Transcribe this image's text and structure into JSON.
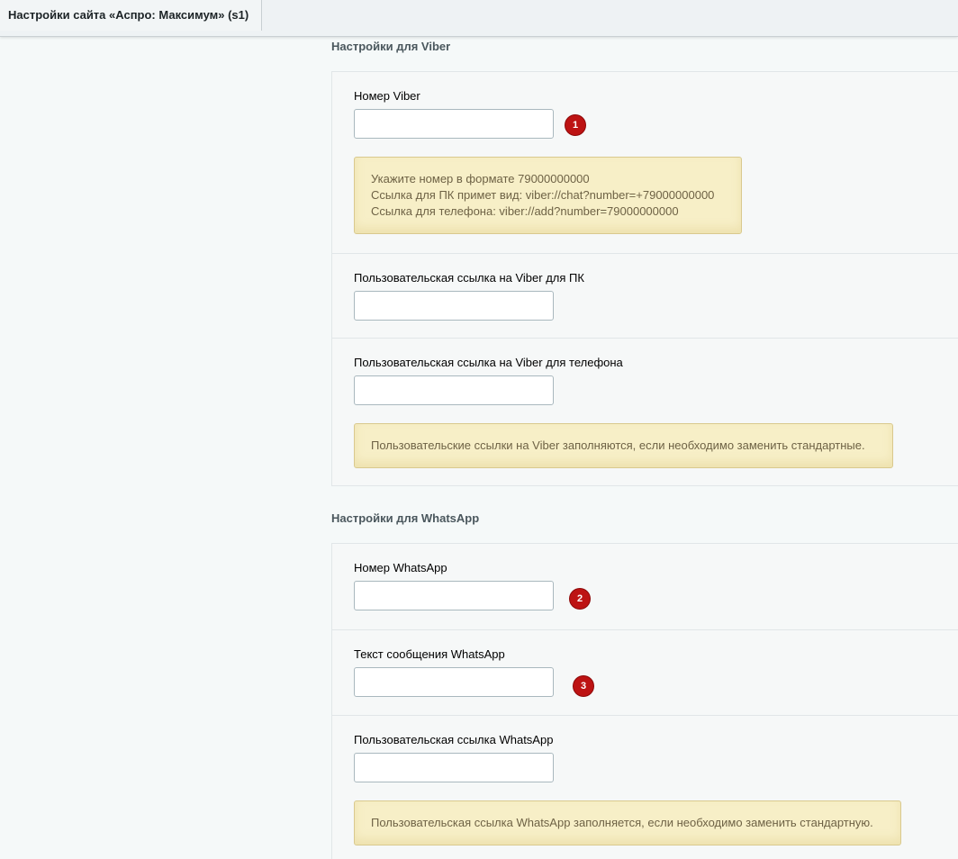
{
  "window": {
    "tab_title": "Настройки сайта «Аспро: Максимум» (s1)"
  },
  "viber": {
    "section_title": "Настройки для Viber",
    "number": {
      "label": "Номер Viber",
      "value": "",
      "badge": "1",
      "hint_lines": [
        "Укажите номер в формате 79000000000",
        "Ссылка для ПК примет вид: viber://chat?number=+79000000000",
        "Ссылка для телефона: viber://add?number=79000000000"
      ]
    },
    "pc_link": {
      "label": "Пользовательская ссылка на Viber для ПК",
      "value": ""
    },
    "phone_link": {
      "label": "Пользовательская ссылка на Viber для телефона",
      "value": "",
      "hint": "Пользовательские ссылки на Viber заполняются, если необходимо заменить стандартные."
    }
  },
  "whatsapp": {
    "section_title": "Настройки для WhatsApp",
    "number": {
      "label": "Номер WhatsApp",
      "value": "",
      "badge": "2"
    },
    "message": {
      "label": "Текст сообщения WhatsApp",
      "value": "",
      "badge": "3"
    },
    "custom_link": {
      "label": "Пользовательская ссылка WhatsApp",
      "value": "",
      "hint": "Пользовательская ссылка WhatsApp заполняется, если необходимо заменить стандартную."
    }
  },
  "colors": {
    "badge": "#bd1313",
    "hint_bg": "#f7efc7",
    "hint_text": "#6e6245",
    "page_bg": "#f5f9f9"
  }
}
